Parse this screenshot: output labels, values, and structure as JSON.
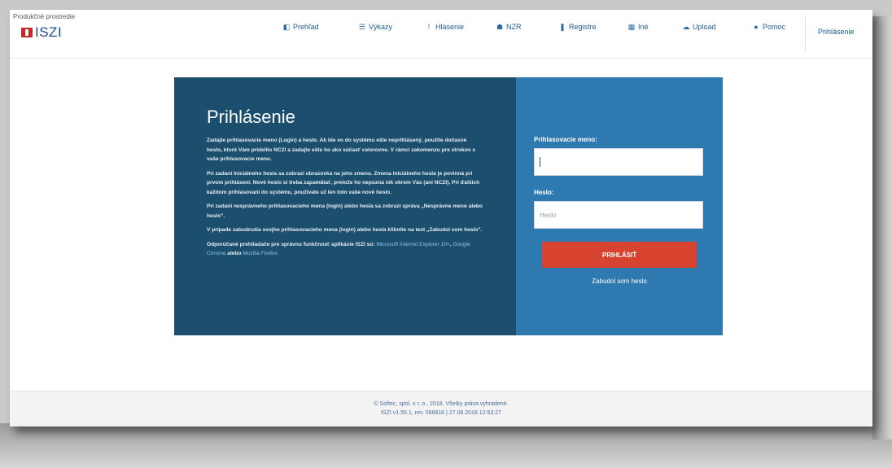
{
  "header": {
    "environment_label": "Produkčné prostredie",
    "brand": "ISZI",
    "nav": [
      {
        "label": "Prehľad",
        "icon": "dashboard-icon",
        "glyph": "◧"
      },
      {
        "label": "Výkazy",
        "icon": "list-icon",
        "glyph": "☰"
      },
      {
        "label": "Hlásenie",
        "icon": "exclamation-icon",
        "glyph": "!"
      },
      {
        "label": "NZR",
        "icon": "users-icon",
        "glyph": "☗"
      },
      {
        "label": "Registre",
        "icon": "bookmark-icon",
        "glyph": "❚"
      },
      {
        "label": "Iné",
        "icon": "grid-icon",
        "glyph": "▦"
      },
      {
        "label": "Upload",
        "icon": "upload-cloud-icon",
        "glyph": "☁"
      },
      {
        "label": "Pomoc",
        "icon": "help-icon",
        "glyph": "●"
      }
    ],
    "login_link": "Prihlásenie"
  },
  "login": {
    "title": "Prihlásenie",
    "paragraphs": [
      "Zadajte prihlasovacie meno (Login) a heslo. Ak ide vo do systému ešte neprihlásený, použite dočasné heslo, ktoré Vám pridelilo NCZI a zadajte ešte ho ako súčasť celorovne. V rámci zakomenzu pre strokov s vaše prihlasovacie meno.",
      "Pri zadaní Iniciálneho hesla sa zobrazí obrazovka na jeho zmenu. Zmena iniciálneho hesla je povinná pri prvom prihlásení. Nové heslo si treba zapamätať, pretože ho nepozná nik okrem Vás (ani NCZI). Pri ďalších každom prihlasovaní do systému, použivate už len toto vaše nové heslo.",
      "Pri zadaní nesprávneho prihlasovacieho mena (login) alebo hesla sa zobrazí správa „Nesprávne meno alebo heslo\".",
      "V prípade zabudnutia svojho prihlasovacieho mena (login) alebo hesla kliknite na text „Zabudol som heslo\".",
      "Odporúčané prehliadače pre správnu funkčnosť aplikácie ISZI sú:"
    ],
    "browsers": [
      "Microsoft Internet Explorer 10+",
      "Google Chrome",
      "Mozilla Firefox"
    ],
    "browsers_joiner": "alebo",
    "username_label": "Prihlasovacie meno:",
    "username_value": "",
    "password_label": "Heslo:",
    "password_placeholder": "Heslo",
    "submit_label": "PRIHLÁSIŤ",
    "forgot_label": "Zabudol som heslo"
  },
  "footer": {
    "line1": "© Softec, spol. s r. o., 2018. Všetky práva vyhradené.",
    "line2": "ISZI v1.55.1, rev. 568816 | 27.08.2018 12:53:27"
  },
  "colors": {
    "panel_dark": "#1c4f6e",
    "panel_blue": "#2e79b0",
    "button_red": "#d8432f",
    "brand_blue": "#1c4d86"
  }
}
